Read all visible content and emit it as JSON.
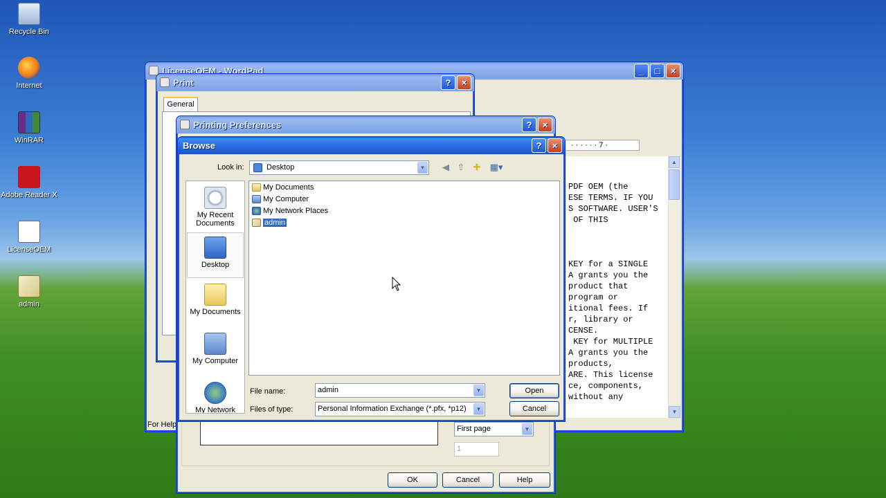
{
  "desktop": {
    "icons": [
      {
        "label": "Recycle Bin",
        "icon": "recycle-bin-icon"
      },
      {
        "label": "Internet",
        "icon": "firefox-icon"
      },
      {
        "label": "WinRAR",
        "icon": "winrar-icon"
      },
      {
        "label": "Adobe Reader X",
        "icon": "adobe-reader-icon"
      },
      {
        "label": "LicenseOEM",
        "icon": "document-icon"
      },
      {
        "label": "admin",
        "icon": "certificate-icon"
      }
    ]
  },
  "wordpad": {
    "title": "LicenseOEM - WordPad",
    "ruler": "· · · · · · 7 ·",
    "status": "For Help",
    "text_lines": [
      "PDF OEM (the",
      "ESE TERMS. IF YOU",
      "S SOFTWARE. USER'S",
      " OF THIS",
      "",
      "",
      "",
      "KEY for a SINGLE",
      "A grants you the",
      "product that",
      "program or",
      "itional fees. If",
      "r, library or",
      "CENSE.",
      " KEY for MULTIPLE",
      "A grants you the",
      "products,",
      "ARE. This license",
      "ce, components,",
      "without any"
    ]
  },
  "print_dialog": {
    "title": "Print",
    "tab": "General"
  },
  "prefs_dialog": {
    "title": "Printing Preferences",
    "page_select": "First page",
    "spinner_value": "1",
    "ok": "OK",
    "cancel": "Cancel",
    "help": "Help"
  },
  "browse_dialog": {
    "title": "Browse",
    "look_in_label": "Look in:",
    "look_in_value": "Desktop",
    "places": [
      "My Recent Documents",
      "Desktop",
      "My Documents",
      "My Computer",
      "My Network"
    ],
    "files": [
      "My Documents",
      "My Computer",
      "My Network Places",
      "admin"
    ],
    "selected_file": "admin",
    "file_name_label": "File name:",
    "file_name_value": "admin",
    "files_of_type_label": "Files of type:",
    "files_of_type_value": "Personal Information Exchange (*.pfx, *p12)",
    "open": "Open",
    "cancel": "Cancel"
  },
  "colors": {
    "title_active": "#2f74e8",
    "dialog_bg": "#ece9d8",
    "selection": "#316ac5"
  }
}
